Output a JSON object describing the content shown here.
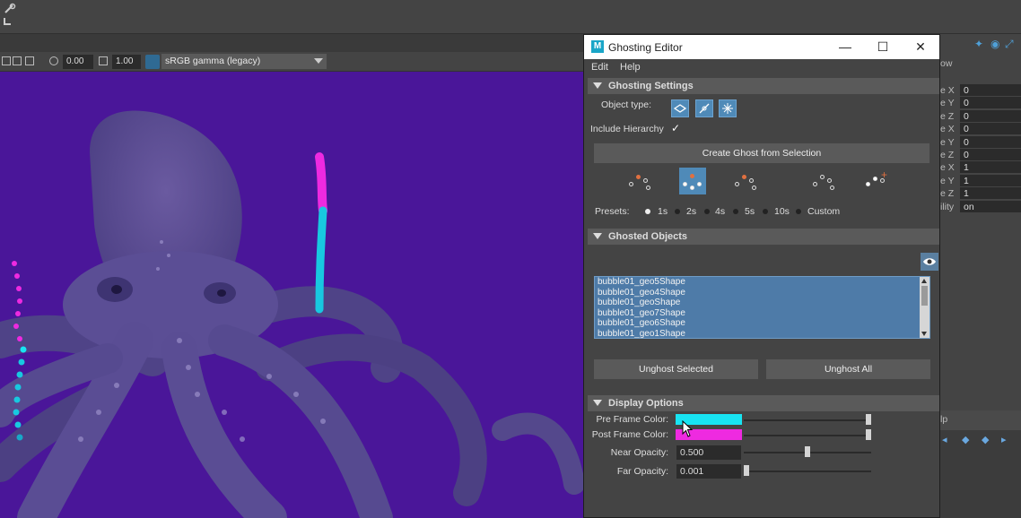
{
  "viewport_toolbar": {
    "exposure_value": "0.00",
    "gamma_value": "1.00",
    "color_space": "sRGB gamma (legacy)"
  },
  "attribute_panel": {
    "header_fragment": "ow",
    "rows": [
      {
        "label": "e X",
        "value": "0"
      },
      {
        "label": "e Y",
        "value": "0"
      },
      {
        "label": "e Z",
        "value": "0"
      },
      {
        "label": "e X",
        "value": "0"
      },
      {
        "label": "e Y",
        "value": "0"
      },
      {
        "label": "e Z",
        "value": "0"
      },
      {
        "label": "e X",
        "value": "1"
      },
      {
        "label": "e Y",
        "value": "1"
      },
      {
        "label": "e Z",
        "value": "1"
      },
      {
        "label": "ility",
        "value": "on"
      }
    ],
    "lower_fragment": "lp"
  },
  "ghosting_editor": {
    "title": "Ghosting Editor",
    "window_controls": {
      "minimize": "—",
      "maximize": "☐",
      "close": "✕"
    },
    "menu": [
      "Edit",
      "Help"
    ],
    "ghosting_settings": {
      "title": "Ghosting Settings",
      "object_type_label": "Object type:",
      "include_hierarchy_label": "Include Hierarchy",
      "include_hierarchy_checked": true,
      "create_button": "Create Ghost from Selection",
      "selected_preset_icon": 1,
      "presets_label": "Presets:",
      "presets": [
        "1s",
        "2s",
        "4s",
        "5s",
        "10s",
        "Custom"
      ],
      "selected_preset": "1s"
    },
    "ghosted_objects": {
      "title": "Ghosted Objects",
      "items": [
        "bubble01_geo5Shape",
        "bubble01_geo4Shape",
        "bubble01_geoShape",
        "bubble01_geo7Shape",
        "bubble01_geo6Shape",
        "bubble01_geo1Shape"
      ],
      "unghost_selected": "Unghost Selected",
      "unghost_all": "Unghost All"
    },
    "display_options": {
      "title": "Display Options",
      "pre_frame_color_label": "Pre Frame Color:",
      "pre_frame_color": "#18e4f2",
      "post_frame_color_label": "Post Frame Color:",
      "post_frame_color": "#ee2ae0",
      "near_opacity_label": "Near Opacity:",
      "near_opacity": "0.500",
      "far_opacity_label": "Far Opacity:",
      "far_opacity": "0.001"
    }
  },
  "colors": {
    "viewport_bg": "#4a1699",
    "selection_blue": "#4f8ab8"
  }
}
